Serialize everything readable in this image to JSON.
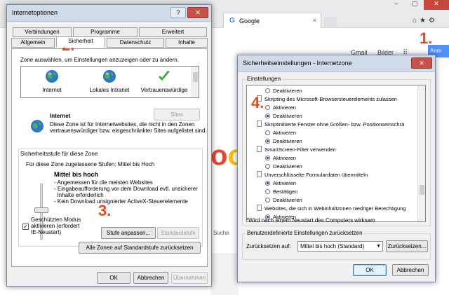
{
  "browser": {
    "tab_title": "Google",
    "tab_close": "×",
    "window_controls": [
      "‒",
      "▢",
      "✕"
    ],
    "toolbar_icons": "⌂★⚙",
    "google_links": [
      "Gmail",
      "Bilder"
    ],
    "apps_icon": "⠿",
    "signin_label": "Anm",
    "logo_fragment": [
      "o",
      "o"
    ],
    "search_button_fragment": "Suche"
  },
  "steps": [
    "1.",
    "2.",
    "3.",
    "4."
  ],
  "internet_options": {
    "title": "Internetoptionen",
    "help_btn": "?",
    "close_btn": "✕",
    "tabs_row1": [
      "Verbindungen",
      "Programme",
      "Erweitert"
    ],
    "tabs_row2": [
      "Allgemein",
      "Sicherheit",
      "Datenschutz",
      "Inhalte"
    ],
    "zone_prompt": "Zone auswählen, um Einstellungen anzuzeigen oder zu ändern.",
    "zones": [
      {
        "label": "Internet",
        "icon": "globe-icon"
      },
      {
        "label": "Lokales Intranet",
        "icon": "globe-icon"
      },
      {
        "label": "Vertrauenswürdige",
        "icon": "checkmark-icon"
      }
    ],
    "sites_button": "Sites",
    "zone_title": "Internet",
    "zone_description_1": "Diese Zone ist für Internetwebsites, die nicht in den Zonen",
    "zone_description_2": "vertrauenswürdiger bzw. eingeschränkter Sites aufgelistet sind.",
    "security_level_group": "Sicherheitsstufe für diese Zone",
    "allowed_levels": "Für diese Zone zugelassene Stufen: Mittel bis Hoch",
    "level_name": "Mittel bis hoch",
    "level_bullets": [
      "- Angemessen für die meisten Websites",
      "- Eingabeaufforderung vor dem Download evtl. unsicherer",
      "  Inhalte erforderlich",
      "- Kein Download unsignierter ActiveX-Steuerelemente"
    ],
    "protected_mode_1": "Geschützten Modus",
    "protected_mode_2": "aktivieren (erfordert",
    "protected_mode_3": "IE-Neustart)",
    "protected_mode_checked": true,
    "checkmark": "✓",
    "custom_level_button": "Stufe anpassen...",
    "default_level_button": "Standardstufe",
    "reset_all_button": "Alle Zonen auf Standardstufe zurücksetzen",
    "ok": "OK",
    "cancel": "Abbrechen",
    "apply": "Übernehmen"
  },
  "security_settings": {
    "title": "Sicherheitseinstellungen - Internetzone",
    "close_btn": "✕",
    "settings_group": "Einstellungen",
    "rows": [
      {
        "kind": "radio",
        "label": "Deaktivieren",
        "checked": false
      },
      {
        "kind": "heading",
        "label": "Skripting des Microsoft-Browsersteuerelements zulassen"
      },
      {
        "kind": "radio",
        "label": "Aktivieren",
        "checked": false
      },
      {
        "kind": "radio",
        "label": "Deaktivieren",
        "checked": true
      },
      {
        "kind": "heading",
        "label": "Skriptinitiierte Fenster ohne Größen- bzw. Positionseinschrä"
      },
      {
        "kind": "radio",
        "label": "Aktivieren",
        "checked": false
      },
      {
        "kind": "radio",
        "label": "Deaktivieren",
        "checked": true
      },
      {
        "kind": "heading",
        "label": "SmartScreen-Filter verwenden"
      },
      {
        "kind": "radio",
        "label": "Aktivieren",
        "checked": true
      },
      {
        "kind": "radio",
        "label": "Deaktivieren",
        "checked": false
      },
      {
        "kind": "heading",
        "label": "Unverschlüsselte Formulardaten übermitteln"
      },
      {
        "kind": "radio",
        "label": "Aktivieren",
        "checked": true
      },
      {
        "kind": "radio",
        "label": "Bestätigen",
        "checked": false
      },
      {
        "kind": "radio",
        "label": "Deaktivieren",
        "checked": false
      },
      {
        "kind": "heading",
        "label": "Websites, die sich in Webinhaltzonen niedriger Berechtigung"
      },
      {
        "kind": "radio",
        "label": "Aktivieren",
        "checked": true
      }
    ],
    "restart_note": "*Wird nach einem Neustart des Computers wirksam",
    "reset_group": "Benutzerdefinierte Einstellungen zurücksetzen",
    "reset_to_label": "Zurücksetzen auf:",
    "reset_to_value": "Mittel bis hoch (Standard)",
    "dropdown_arrow": "▼",
    "reset_button": "Zurücksetzen...",
    "ok": "OK",
    "cancel": "Abbrechen"
  },
  "colors": {
    "step_marker": "#e8491d",
    "globe": "#2f78c4",
    "checkmark": "#3aa83a"
  }
}
